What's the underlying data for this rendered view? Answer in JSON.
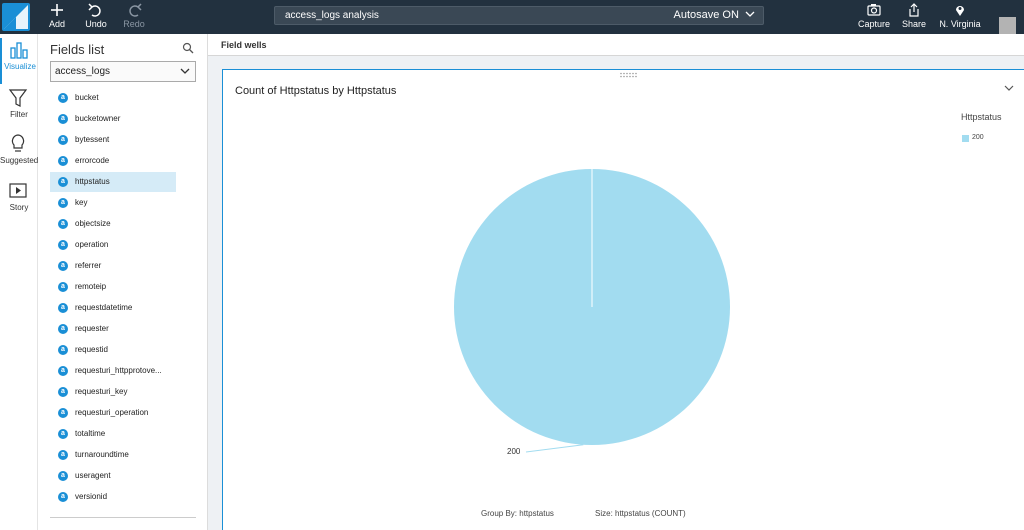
{
  "toolbar": {
    "add_label": "Add",
    "undo_label": "Undo",
    "redo_label": "Redo",
    "analysis_name": "access_logs analysis",
    "autosave_label": "Autosave ON",
    "capture_label": "Capture",
    "share_label": "Share",
    "region_label": "N. Virginia"
  },
  "rail": {
    "items": [
      {
        "label": "Visualize",
        "icon": "bar-chart-icon",
        "active": true
      },
      {
        "label": "Filter",
        "icon": "filter-icon",
        "active": false
      },
      {
        "label": "Suggested",
        "icon": "lightbulb-icon",
        "active": false
      },
      {
        "label": "Story",
        "icon": "story-icon",
        "active": false
      }
    ]
  },
  "fields_panel": {
    "title": "Fields list",
    "dataset": "access_logs",
    "field_type_glyph": "a",
    "fields": [
      "bucket",
      "bucketowner",
      "bytessent",
      "errorcode",
      "httpstatus",
      "key",
      "objectsize",
      "operation",
      "referrer",
      "remoteip",
      "requestdatetime",
      "requester",
      "requestid",
      "requesturi_httpprotove...",
      "requesturi_key",
      "requesturi_operation",
      "totaltime",
      "turnaroundtime",
      "useragent",
      "versionid"
    ],
    "selected_field": "httpstatus"
  },
  "main": {
    "field_wells_label": "Field wells"
  },
  "visual": {
    "title": "Count of Httpstatus by Httpstatus",
    "legend_title": "Httpstatus",
    "group_by_label": "Group By: httpstatus",
    "size_label": "Size: httpstatus (COUNT)"
  },
  "chart_data": {
    "type": "pie",
    "title": "Count of Httpstatus by Httpstatus",
    "categories": [
      "200"
    ],
    "values": [
      1
    ],
    "legend_title": "Httpstatus",
    "legend_position": "top-right",
    "colors": [
      "#a2dcf0"
    ],
    "slice_labels": [
      "200"
    ]
  },
  "colors": {
    "topbar": "#22313f",
    "accent": "#1a8fd6",
    "selected_row": "#d5ebf7",
    "pie_fill": "#a2dcf0"
  }
}
